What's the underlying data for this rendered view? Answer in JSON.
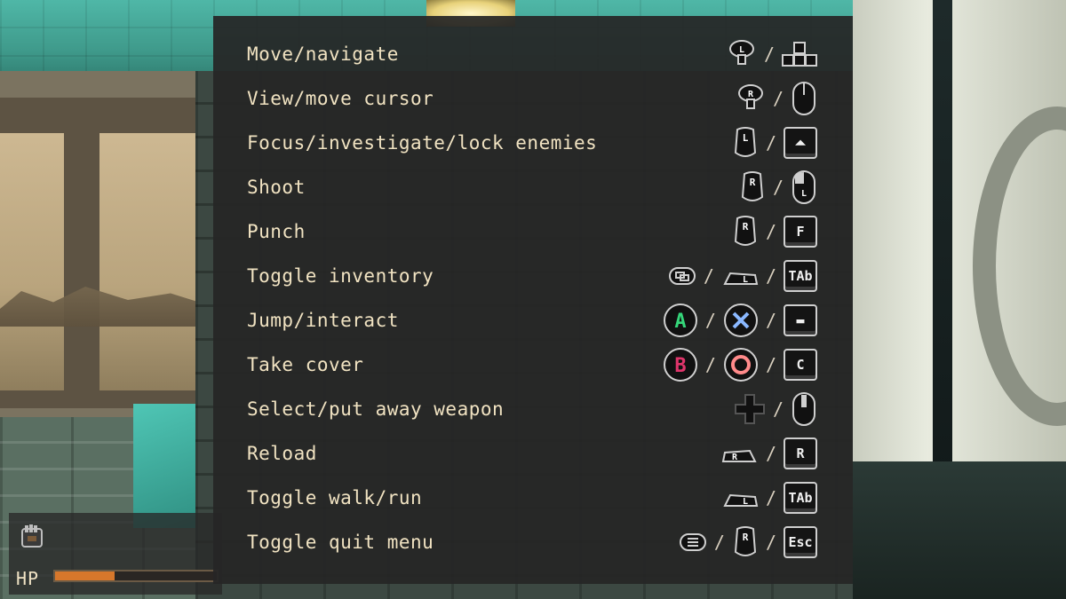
{
  "hud": {
    "hp_label": "HP",
    "hp_fraction": 0.37,
    "weapon_icon": "fist-icon",
    "hp_color": "#d7772b"
  },
  "controls": [
    {
      "action": "Move/navigate",
      "icons": [
        "left-stick-icon",
        "wasd-keys-icon"
      ]
    },
    {
      "action": "View/move cursor",
      "icons": [
        "right-stick-icon",
        "mouse-icon"
      ]
    },
    {
      "action": "Focus/investigate/lock enemies",
      "icons": [
        "left-trigger-icon",
        "up-arrow-key-icon"
      ]
    },
    {
      "action": "Shoot",
      "icons": [
        "right-trigger-icon",
        "left-mouse-button-icon"
      ]
    },
    {
      "action": "Punch",
      "icons": [
        "right-trigger-icon",
        "f-key-icon"
      ],
      "key_text": "F"
    },
    {
      "action": "Toggle inventory",
      "icons": [
        "view-button-icon",
        "left-bumper-icon",
        "tab-key-icon"
      ],
      "key_text": "TAb"
    },
    {
      "action": "Jump/interact",
      "icons": [
        "a-button-icon",
        "cross-button-icon",
        "space-key-icon"
      ],
      "button_text": "A"
    },
    {
      "action": "Take cover",
      "icons": [
        "b-button-icon",
        "circle-button-icon",
        "c-key-icon"
      ],
      "button_text": "B",
      "key_text": "C"
    },
    {
      "action": "Select/put away weapon",
      "icons": [
        "dpad-icon",
        "mouse-wheel-icon"
      ]
    },
    {
      "action": "Reload",
      "icons": [
        "right-bumper-icon",
        "r-key-icon"
      ],
      "key_text": "R"
    },
    {
      "action": "Toggle walk/run",
      "icons": [
        "left-bumper-icon",
        "tab-key-icon"
      ],
      "key_text": "TAb"
    },
    {
      "action": "Toggle quit menu",
      "icons": [
        "menu-button-icon",
        "right-trigger-icon",
        "esc-key-icon"
      ],
      "key_text": "Esc"
    }
  ],
  "separator": "/",
  "colors": {
    "panel_bg": "#262626",
    "label_text": "#f1e3c2",
    "a_button": "#35d67a",
    "b_button": "#e0356b",
    "cross_button": "#8ab8ff",
    "circle_button": "#ff8a8a"
  }
}
